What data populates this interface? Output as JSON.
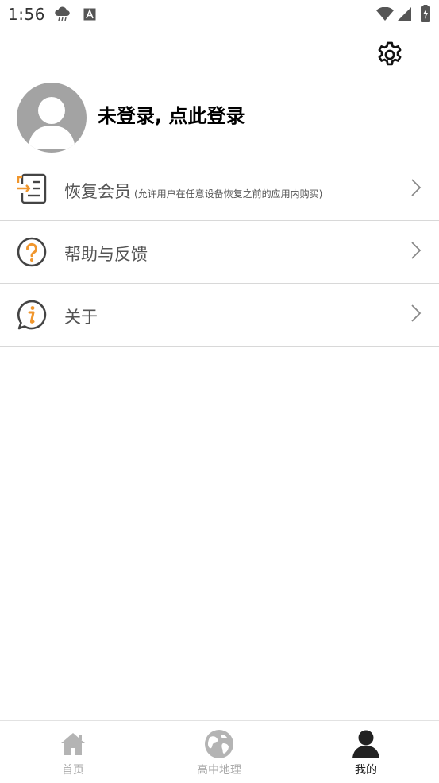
{
  "status_bar": {
    "time": "1:56",
    "icons": [
      "cloud-rain-icon",
      "font-a-icon",
      "wifi-icon",
      "signal-icon",
      "battery-charging-icon"
    ]
  },
  "header": {
    "settings_icon": "gear-icon"
  },
  "profile": {
    "avatar_icon": "user-avatar-icon",
    "login_prompt": "未登录, 点此登录"
  },
  "menu": {
    "items": [
      {
        "label": "恢复会员",
        "note": "(允许用户在任意设备恢复之前的应用内购买)",
        "icon": "restore-membership-icon"
      },
      {
        "label": "帮助与反馈",
        "note": "",
        "icon": "help-question-icon"
      },
      {
        "label": "关于",
        "note": "",
        "icon": "info-icon"
      }
    ]
  },
  "bottom_nav": {
    "tabs": [
      {
        "label": "首页",
        "icon": "home-icon",
        "active": false
      },
      {
        "label": "高中地理",
        "icon": "globe-icon",
        "active": false
      },
      {
        "label": "我的",
        "icon": "person-icon",
        "active": true
      }
    ]
  },
  "colors": {
    "accent_orange": "#f0962d",
    "icon_dark": "#444444",
    "inactive_nav": "#aaaaaa",
    "avatar_gray": "#a3a3a3",
    "divider": "#d8d8d8"
  }
}
